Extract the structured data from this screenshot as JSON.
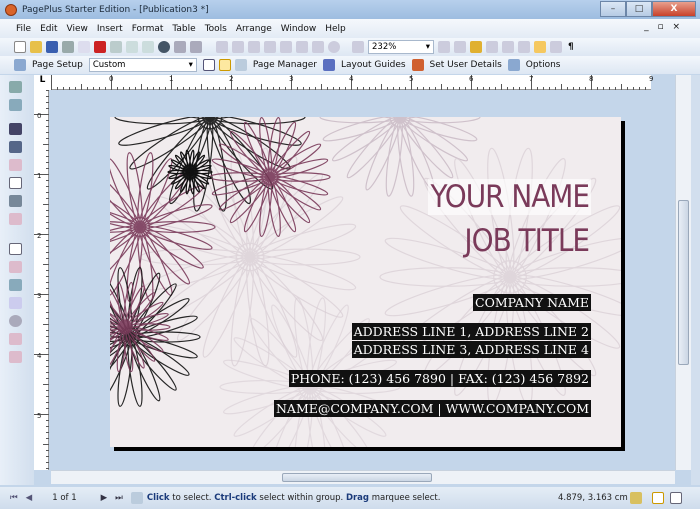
{
  "window": {
    "title": "PagePlus Starter Edition  - [Publication3 *]",
    "minimize": "–",
    "maximize": "□",
    "close": "X",
    "mdi": "_ ▫ ×"
  },
  "menu": [
    "File",
    "Edit",
    "View",
    "Insert",
    "Format",
    "Table",
    "Tools",
    "Arrange",
    "Window",
    "Help"
  ],
  "toolbar": {
    "zoom": "232%",
    "pilcrow": "¶"
  },
  "context_bar": {
    "page_setup": "Page Setup",
    "page_size": "Custom",
    "page_manager": "Page Manager",
    "layout_guides": "Layout Guides",
    "set_user_details": "Set User Details",
    "options": "Options"
  },
  "ruler": {
    "h": [
      "0",
      "1",
      "2",
      "3",
      "4",
      "5",
      "6",
      "7",
      "8",
      "9"
    ],
    "v": [
      "0",
      "1",
      "2",
      "3",
      "4",
      "5"
    ],
    "corner": "L"
  },
  "card": {
    "name": "YOUR NAME",
    "job_title": "JOB TITLE",
    "company": "COMPANY NAME",
    "address1": "ADDRESS LINE 1, ADDRESS LINE 2",
    "address2": "ADDRESS LINE 3, ADDRESS LINE 4",
    "phone": "PHONE: (123) 456 7890  |  FAX: (123) 456 7892",
    "web": "NAME@COMPANY.COM  |  WWW.COMPANY.COM",
    "colors": {
      "accent": "#7a3a5a",
      "bg": "#f1ecee"
    }
  },
  "status": {
    "page": "1 of 1",
    "hint_click": "Click",
    "hint1": " to select. ",
    "hint_ctrl": "Ctrl-click",
    "hint2": " select within group. ",
    "hint_drag": "Drag",
    "hint3": " marquee select.",
    "coords": "4.879, 3.163 cm"
  }
}
